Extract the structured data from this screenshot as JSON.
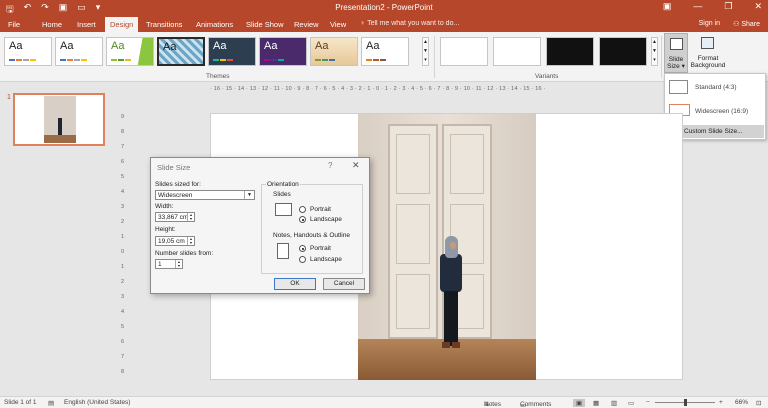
{
  "app": {
    "title": "Presentation2 - PowerPoint"
  },
  "qat": {
    "save_icon": "save-icon",
    "undo_icon": "undo-icon",
    "redo_icon": "redo-icon",
    "start_icon": "start-from-beginning-icon",
    "new_icon": "new-icon",
    "more_icon": "customize-icon"
  },
  "window": {
    "minimize": "—",
    "restore": "❐",
    "close": "✕"
  },
  "tabs": [
    {
      "label": "File"
    },
    {
      "label": "Home"
    },
    {
      "label": "Insert"
    },
    {
      "label": "Design"
    },
    {
      "label": "Transitions"
    },
    {
      "label": "Animations"
    },
    {
      "label": "Slide Show"
    },
    {
      "label": "Review"
    },
    {
      "label": "View"
    }
  ],
  "tell_me": "Tell me what you want to do...",
  "signin": "Sign in",
  "share": "Share",
  "ribbon": {
    "themes_label": "Themes",
    "variants_label": "Variants",
    "theme_text": "Aa",
    "slide_size": "Slide Size",
    "format_background_1": "Format",
    "format_background_2": "Background"
  },
  "dropdown": {
    "standard": "Standard (4:3)",
    "widescreen": "Widescreen (16:9)",
    "custom": "Custom Slide Size..."
  },
  "thumbnails": {
    "slide_number": "1"
  },
  "dialog": {
    "title": "Slide Size",
    "help": "?",
    "close": "✕",
    "sized_for_label": "Slides sized for:",
    "sized_for_value": "Widescreen",
    "width_label": "Width:",
    "width_value": "33,867 cm",
    "height_label": "Height:",
    "height_value": "19,05 cm",
    "number_from_label": "Number slides from:",
    "number_from_value": "1",
    "orientation_label": "Orientation",
    "slides_label": "Slides",
    "slides_portrait": "Portrait",
    "slides_landscape": "Landscape",
    "notes_label": "Notes, Handouts & Outline",
    "notes_portrait": "Portrait",
    "notes_landscape": "Landscape",
    "ok": "OK",
    "cancel": "Cancel"
  },
  "status": {
    "slide_of": "Slide 1 of 1",
    "language": "English (United States)",
    "notes": "Notes",
    "comments": "Comments",
    "zoom": "66%"
  },
  "colors": {
    "accent": "#b7472a",
    "selection": "#e1805d"
  }
}
